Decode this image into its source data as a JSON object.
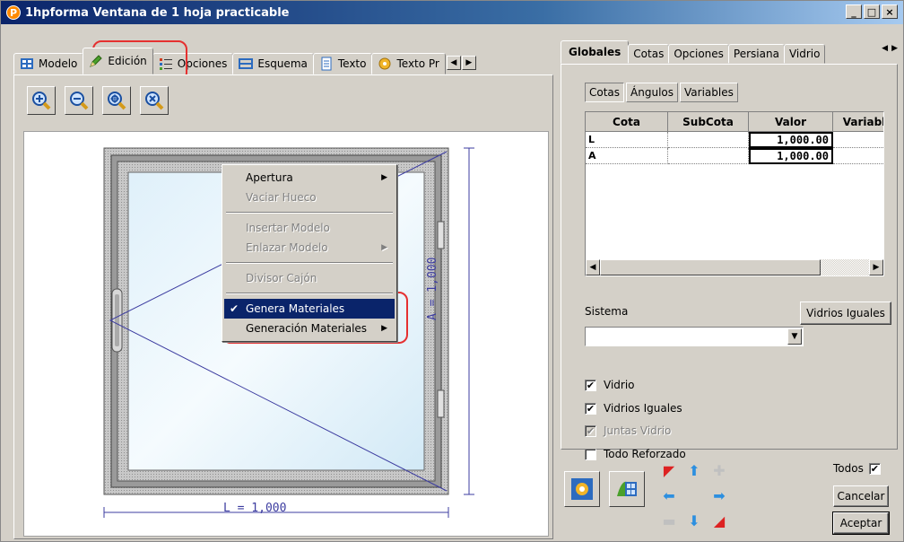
{
  "window": {
    "app_icon_letter": "P",
    "title": "1hpforma Ventana de 1 hoja practicable",
    "controls": [
      "_",
      "□",
      "×"
    ]
  },
  "left_tabs": [
    {
      "label": "Modelo",
      "icon": "grid-icon"
    },
    {
      "label": "Edición",
      "icon": "pencil-icon"
    },
    {
      "label": "Opciones",
      "icon": "list-icon"
    },
    {
      "label": "Esquema",
      "icon": "schema-icon"
    },
    {
      "label": "Texto",
      "icon": "document-icon"
    },
    {
      "label": "Texto Pr",
      "icon": "gear-icon"
    }
  ],
  "zoom_tools": [
    "zoom-in-icon",
    "zoom-out-icon",
    "zoom-extents-icon",
    "zoom-reset-icon"
  ],
  "drawing": {
    "width_dim": "L = 1,000",
    "height_dim": "A = 1,000"
  },
  "context_menu": {
    "items": [
      {
        "label": "Apertura",
        "submenu": true,
        "disabled": false
      },
      {
        "label": "Vaciar Hueco",
        "submenu": false,
        "disabled": true
      },
      {
        "label": "Insertar Modelo",
        "submenu": false,
        "disabled": true
      },
      {
        "label": "Enlazar Modelo",
        "submenu": true,
        "disabled": true
      },
      {
        "label": "Divisor Cajón",
        "submenu": false,
        "disabled": true
      },
      {
        "label": "Genera Materiales",
        "submenu": false,
        "checked": true,
        "selected": true
      },
      {
        "label": "Generación Materiales",
        "submenu": true,
        "disabled": false
      }
    ]
  },
  "right_tabs": [
    {
      "label": "Globales",
      "active": true
    },
    {
      "label": "Cotas"
    },
    {
      "label": "Opciones"
    },
    {
      "label": "Persiana"
    },
    {
      "label": "Vidrio"
    }
  ],
  "sub_tabs": [
    "Cotas",
    "Ángulos",
    "Variables"
  ],
  "grid": {
    "headers": [
      "Cota",
      "SubCota",
      "Valor",
      "Variabl"
    ],
    "rows": [
      {
        "cota": "L",
        "subcota": "",
        "valor": "1,000.00"
      },
      {
        "cota": "A",
        "subcota": "",
        "valor": "1,000.00"
      }
    ]
  },
  "sistema": {
    "label": "Sistema",
    "value": "",
    "vidrios_iguales_button": "Vidrios Iguales"
  },
  "checks": [
    {
      "label": "Vidrio",
      "checked": true,
      "disabled": false
    },
    {
      "label": "Vidrios Iguales",
      "checked": true,
      "disabled": false
    },
    {
      "label": "Juntas Vidrio",
      "checked": true,
      "disabled": true
    },
    {
      "label": "Todo Reforzado",
      "checked": false,
      "disabled": false
    }
  ],
  "bottom": {
    "todos_label": "Todos",
    "todos_checked": true,
    "cancel_label": "Cancelar",
    "accept_label": "Aceptar"
  },
  "colors": {
    "title_bar": "#0a246a",
    "selection": "#0a246a",
    "highlight_circle": "#e53030",
    "dimension_line": "#3c3ca0"
  }
}
